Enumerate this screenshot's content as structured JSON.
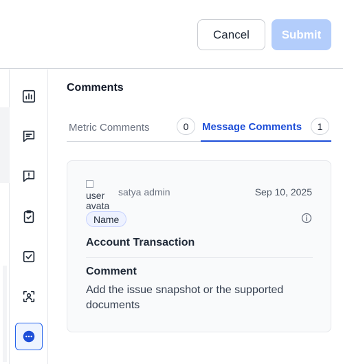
{
  "header": {
    "cancel_label": "Cancel",
    "submit_label": "Submit"
  },
  "rail": {
    "icons": [
      "bar-chart-icon",
      "message-square-icon",
      "message-alert-icon",
      "clipboard-check-icon",
      "checkbox-icon",
      "face-scan-icon",
      "chat-bubble-dots-icon"
    ],
    "active_icon": "chat-bubble-dots-icon",
    "accent_color": "#2563eb"
  },
  "panel": {
    "title": "Comments",
    "tabs": [
      {
        "label": "Metric Comments",
        "count": "0",
        "active": false
      },
      {
        "label": "Message Comments",
        "count": "1",
        "active": true
      }
    ]
  },
  "comment": {
    "avatar_alt": "user avatar",
    "author": "satya admin",
    "date": "Sep 10, 2025",
    "tag": "Name",
    "subject": "Account Transaction",
    "body_heading": "Comment",
    "body": "Add the issue snapshot or the supported documents"
  }
}
